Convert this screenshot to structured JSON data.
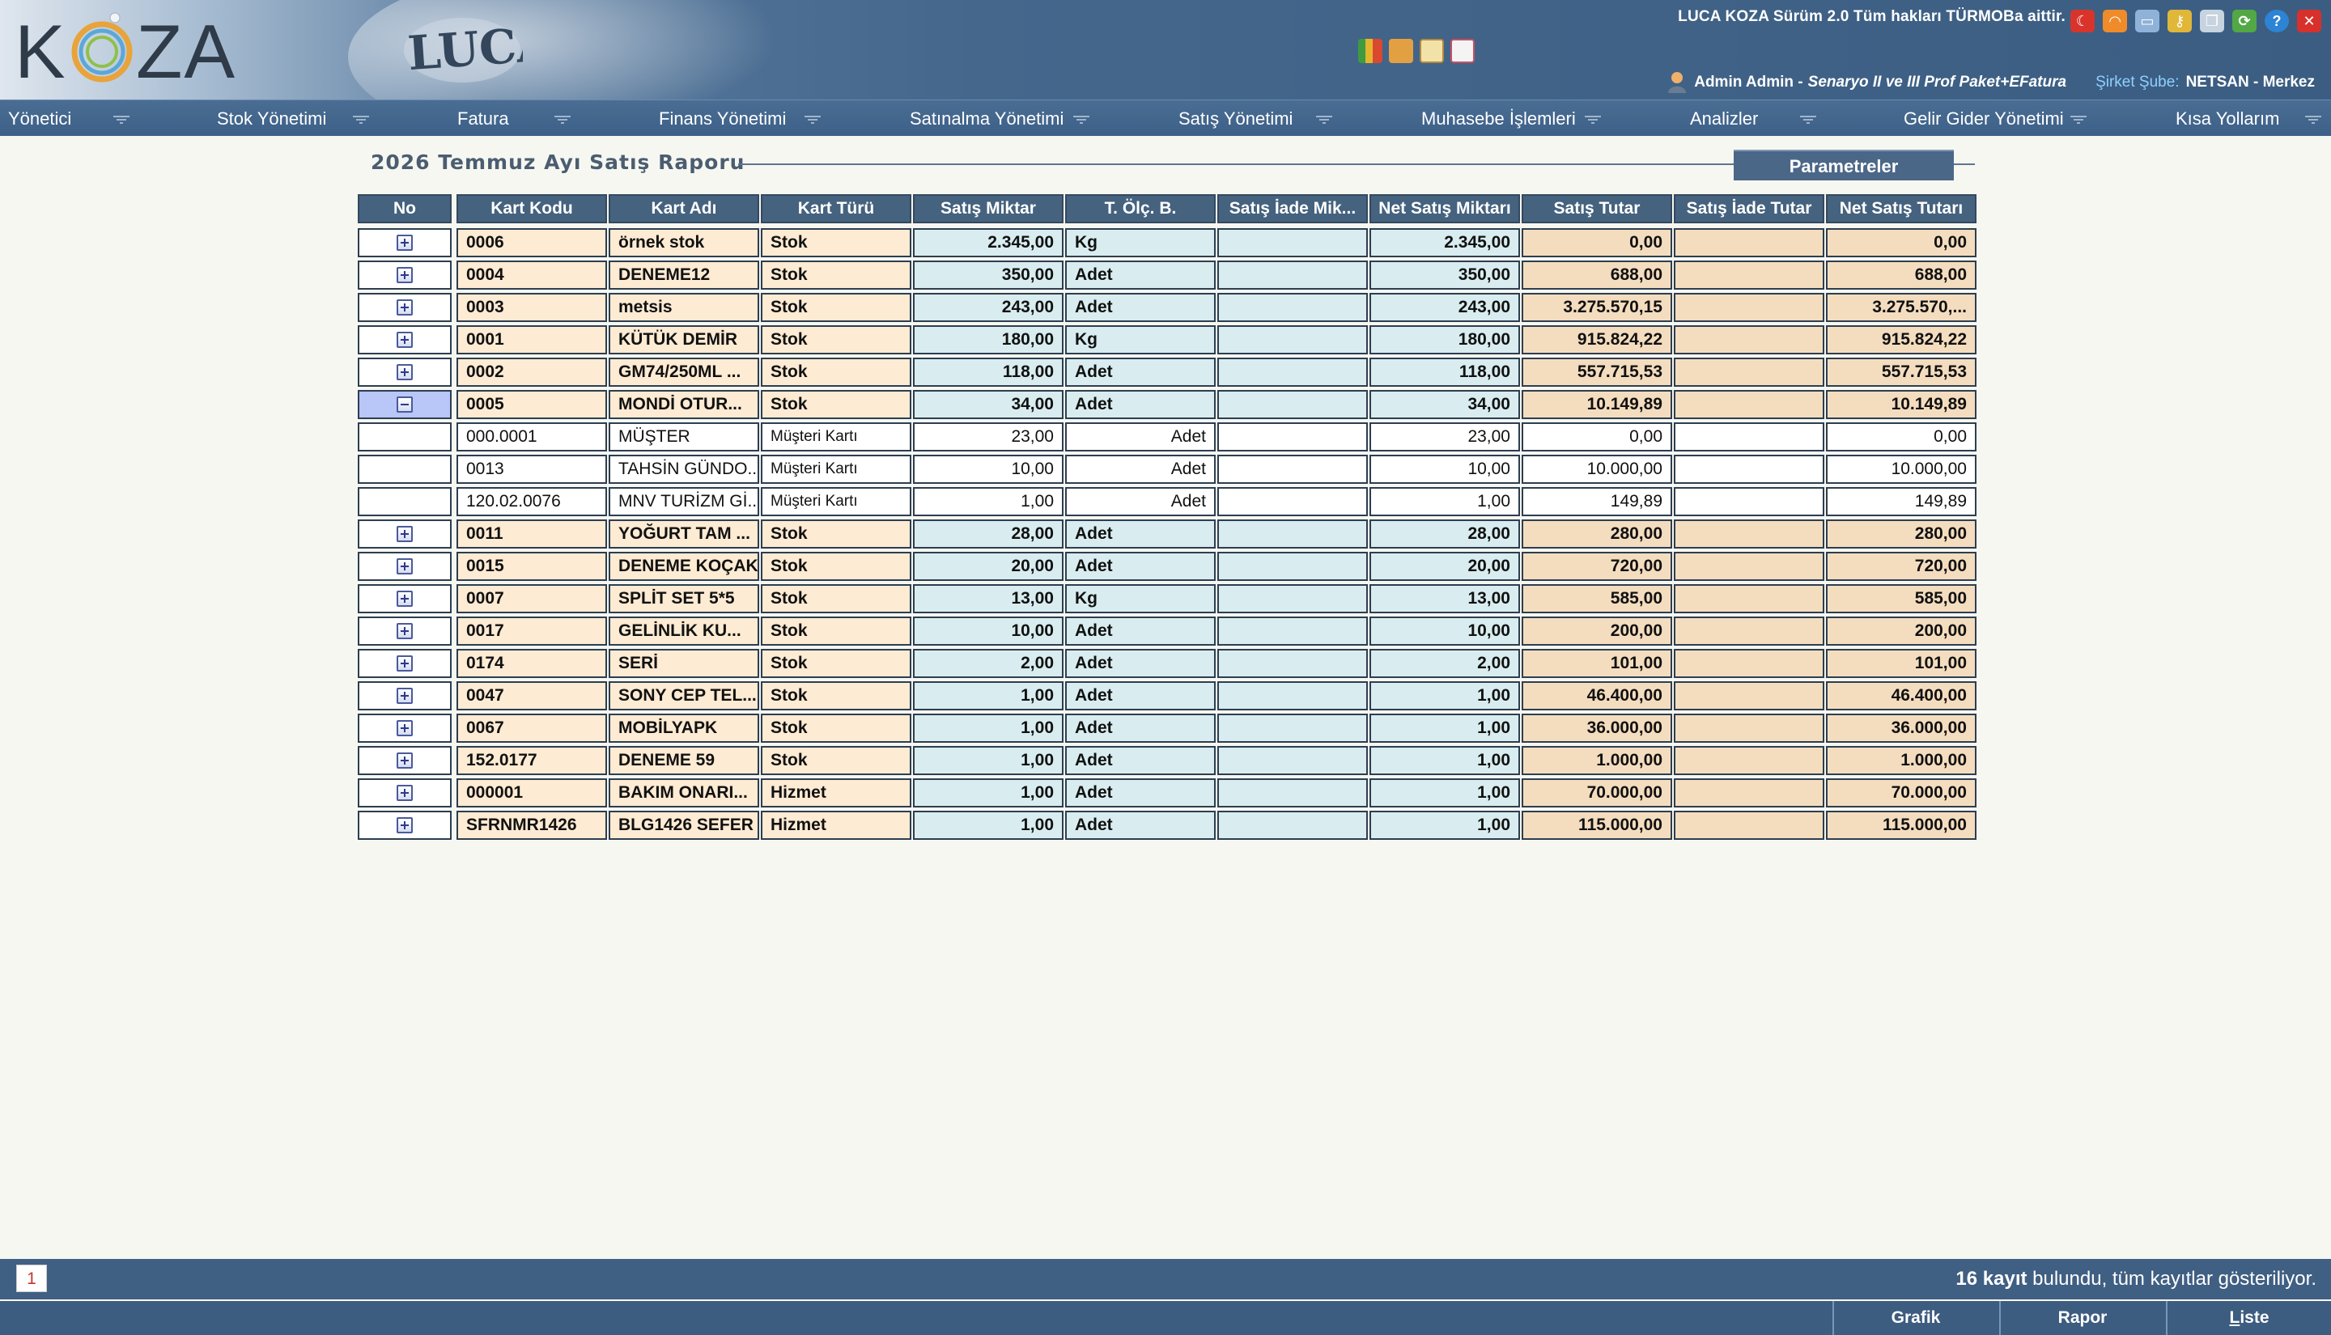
{
  "header": {
    "logo_text": "KOZA",
    "luca_logo_text": "LUCA",
    "version_text": "LUCA KOZA Sürüm 2.0 Tüm hakları TÜRMOBa aittir.",
    "user": "Admin Admin -",
    "scenario": "Senaryo II ve III Prof Paket+EFatura",
    "branch_label": "Şirket Şube:",
    "branch_value": "NETSAN - Merkez"
  },
  "menu": [
    {
      "label": "Yönetici"
    },
    {
      "label": "Stok Yönetimi"
    },
    {
      "label": "Fatura"
    },
    {
      "label": "Finans Yönetimi"
    },
    {
      "label": "Satınalma Yönetimi"
    },
    {
      "label": "Satış Yönetimi"
    },
    {
      "label": "Muhasebe İşlemleri"
    },
    {
      "label": "Analizler"
    },
    {
      "label": "Gelir Gider Yönetimi"
    },
    {
      "label": "Kısa Yollarım"
    }
  ],
  "report": {
    "title": "2026 Temmuz Ayı Satış Raporu",
    "params_button": "Parametreler"
  },
  "table": {
    "headers": [
      "No",
      "Kart Kodu",
      "Kart Adı",
      "Kart Türü",
      "Satış Miktar",
      "T. Ölç. B.",
      "Satış İade Mik...",
      "Net Satış Miktarı",
      "Satış Tutar",
      "Satış İade Tutar",
      "Net Satış Tutarı"
    ],
    "rows": [
      {
        "kind": "main",
        "expand": "plus",
        "code": "0006",
        "name": "örnek stok",
        "type": "Stok",
        "qty": "2.345,00",
        "unit": "Kg",
        "ret_qty": "",
        "net_qty": "2.345,00",
        "amount": "0,00",
        "ret_amount": "",
        "net_amount": "0,00"
      },
      {
        "kind": "main",
        "expand": "plus",
        "code": "0004",
        "name": "DENEME12",
        "type": "Stok",
        "qty": "350,00",
        "unit": "Adet",
        "ret_qty": "",
        "net_qty": "350,00",
        "amount": "688,00",
        "ret_amount": "",
        "net_amount": "688,00"
      },
      {
        "kind": "main",
        "expand": "plus",
        "code": "0003",
        "name": "metsis",
        "type": "Stok",
        "qty": "243,00",
        "unit": "Adet",
        "ret_qty": "",
        "net_qty": "243,00",
        "amount": "3.275.570,15",
        "ret_amount": "",
        "net_amount": "3.275.570,..."
      },
      {
        "kind": "main",
        "expand": "plus",
        "code": "0001",
        "name": "KÜTÜK DEMİR",
        "type": "Stok",
        "qty": "180,00",
        "unit": "Kg",
        "ret_qty": "",
        "net_qty": "180,00",
        "amount": "915.824,22",
        "ret_amount": "",
        "net_amount": "915.824,22"
      },
      {
        "kind": "main",
        "expand": "plus",
        "code": "0002",
        "name": "GM74/250ML ...",
        "type": "Stok",
        "qty": "118,00",
        "unit": "Adet",
        "ret_qty": "",
        "net_qty": "118,00",
        "amount": "557.715,53",
        "ret_amount": "",
        "net_amount": "557.715,53"
      },
      {
        "kind": "main",
        "expand": "minus",
        "selected": true,
        "code": "0005",
        "name": "MONDİ OTUR...",
        "type": "Stok",
        "qty": "34,00",
        "unit": "Adet",
        "ret_qty": "",
        "net_qty": "34,00",
        "amount": "10.149,89",
        "ret_amount": "",
        "net_amount": "10.149,89"
      },
      {
        "kind": "sub",
        "code": "000.0001",
        "name": "MÜŞTER",
        "type": "Müşteri Kartı",
        "qty": "23,00",
        "unit": "Adet",
        "ret_qty": "",
        "net_qty": "23,00",
        "amount": "0,00",
        "ret_amount": "",
        "net_amount": "0,00"
      },
      {
        "kind": "sub",
        "code": "0013",
        "name": "TAHSİN GÜNDO...",
        "type": "Müşteri Kartı",
        "qty": "10,00",
        "unit": "Adet",
        "ret_qty": "",
        "net_qty": "10,00",
        "amount": "10.000,00",
        "ret_amount": "",
        "net_amount": "10.000,00"
      },
      {
        "kind": "sub",
        "code": "120.02.0076",
        "name": "MNV TURİZM Gİ...",
        "type": "Müşteri Kartı",
        "qty": "1,00",
        "unit": "Adet",
        "ret_qty": "",
        "net_qty": "1,00",
        "amount": "149,89",
        "ret_amount": "",
        "net_amount": "149,89"
      },
      {
        "kind": "main",
        "expand": "plus",
        "code": "0011",
        "name": "YOĞURT TAM ...",
        "type": "Stok",
        "qty": "28,00",
        "unit": "Adet",
        "ret_qty": "",
        "net_qty": "28,00",
        "amount": "280,00",
        "ret_amount": "",
        "net_amount": "280,00"
      },
      {
        "kind": "main",
        "expand": "plus",
        "code": "0015",
        "name": "DENEME KOÇAK",
        "type": "Stok",
        "qty": "20,00",
        "unit": "Adet",
        "ret_qty": "",
        "net_qty": "20,00",
        "amount": "720,00",
        "ret_amount": "",
        "net_amount": "720,00"
      },
      {
        "kind": "main",
        "expand": "plus",
        "code": "0007",
        "name": "SPLİT SET 5*5",
        "type": "Stok",
        "qty": "13,00",
        "unit": "Kg",
        "ret_qty": "",
        "net_qty": "13,00",
        "amount": "585,00",
        "ret_amount": "",
        "net_amount": "585,00"
      },
      {
        "kind": "main",
        "expand": "plus",
        "code": "0017",
        "name": "GELİNLİK KU...",
        "type": "Stok",
        "qty": "10,00",
        "unit": "Adet",
        "ret_qty": "",
        "net_qty": "10,00",
        "amount": "200,00",
        "ret_amount": "",
        "net_amount": "200,00"
      },
      {
        "kind": "main",
        "expand": "plus",
        "code": "0174",
        "name": "SERİ",
        "type": "Stok",
        "qty": "2,00",
        "unit": "Adet",
        "ret_qty": "",
        "net_qty": "2,00",
        "amount": "101,00",
        "ret_amount": "",
        "net_amount": "101,00"
      },
      {
        "kind": "main",
        "expand": "plus",
        "code": "0047",
        "name": "SONY CEP TEL...",
        "type": "Stok",
        "qty": "1,00",
        "unit": "Adet",
        "ret_qty": "",
        "net_qty": "1,00",
        "amount": "46.400,00",
        "ret_amount": "",
        "net_amount": "46.400,00"
      },
      {
        "kind": "main",
        "expand": "plus",
        "code": "0067",
        "name": "MOBİLYAPK",
        "type": "Stok",
        "qty": "1,00",
        "unit": "Adet",
        "ret_qty": "",
        "net_qty": "1,00",
        "amount": "36.000,00",
        "ret_amount": "",
        "net_amount": "36.000,00"
      },
      {
        "kind": "main",
        "expand": "plus",
        "code": "152.0177",
        "name": "DENEME 59",
        "type": "Stok",
        "qty": "1,00",
        "unit": "Adet",
        "ret_qty": "",
        "net_qty": "1,00",
        "amount": "1.000,00",
        "ret_amount": "",
        "net_amount": "1.000,00"
      },
      {
        "kind": "main",
        "expand": "plus",
        "code": "000001",
        "name": "BAKIM ONARI...",
        "type": "Hizmet",
        "qty": "1,00",
        "unit": "Adet",
        "ret_qty": "",
        "net_qty": "1,00",
        "amount": "70.000,00",
        "ret_amount": "",
        "net_amount": "70.000,00"
      },
      {
        "kind": "main",
        "expand": "plus",
        "code": "SFRNMR1426",
        "name": "BLG1426 SEFER",
        "type": "Hizmet",
        "qty": "1,00",
        "unit": "Adet",
        "ret_qty": "",
        "net_qty": "1,00",
        "amount": "115.000,00",
        "ret_amount": "",
        "net_amount": "115.000,00"
      }
    ]
  },
  "footer": {
    "page": "1",
    "record_count": "16 kayıt",
    "record_suffix": " bulundu, tüm kayıtlar gösteriliyor.",
    "buttons": [
      {
        "label": "Grafik",
        "underline_first": false
      },
      {
        "label": "Rapor",
        "underline_first": false
      },
      {
        "label": "Liste",
        "underline_first": true
      }
    ]
  },
  "colors": {
    "header_blue": "#3b5d82",
    "menu_blue": "#3d6088",
    "table_header": "#45627f",
    "code_cell": "#fdebd3",
    "qty_cell": "#d9edf0",
    "amount_cell": "#f4ddbf",
    "selected_row": "#b8c6f8"
  }
}
